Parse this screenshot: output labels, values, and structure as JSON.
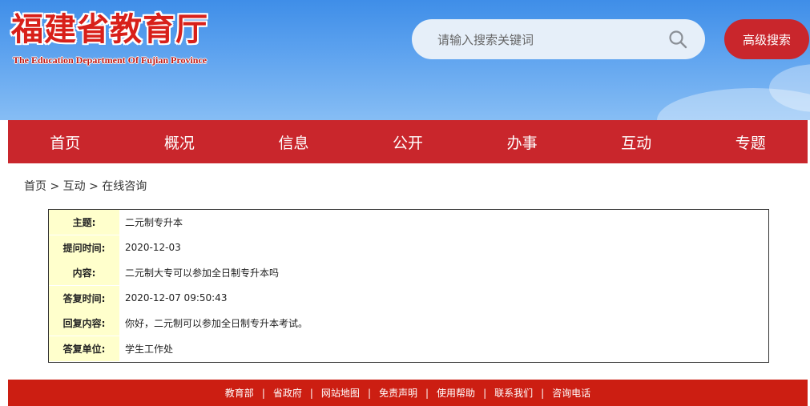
{
  "header": {
    "logo_cn": "福建省教育厅",
    "logo_en": "The Education Department Of Fujian Province",
    "search_placeholder": "请输入搜索关键词",
    "advanced_search": "高级搜索"
  },
  "nav": [
    "首页",
    "概况",
    "信息",
    "公开",
    "办事",
    "互动",
    "专题"
  ],
  "breadcrumb": {
    "items": [
      "首页",
      "互动",
      "在线咨询"
    ],
    "separator": ">"
  },
  "detail": [
    {
      "label": "主题:",
      "value": "二元制专升本"
    },
    {
      "label": "提问时间:",
      "value": "2020-12-03"
    },
    {
      "label": "内容:",
      "value": "二元制大专可以参加全日制专升本吗"
    },
    {
      "label": "答复时间:",
      "value": "2020-12-07 09:50:43"
    },
    {
      "label": "回复内容:",
      "value": "你好，二元制可以参加全日制专升本考试。"
    },
    {
      "label": "答复单位:",
      "value": "学生工作处"
    }
  ],
  "footer": {
    "links": [
      "教育部",
      "省政府",
      "网站地图",
      "免责声明",
      "使用帮助",
      "联系我们",
      "咨询电话"
    ],
    "separator": "|"
  },
  "colors": {
    "brand_red": "#c9262c",
    "footer_red": "#cc1e12",
    "label_bg": "#ffffcc",
    "sky_blue": "#5ea3ef"
  },
  "icons": {
    "search": "search-icon"
  }
}
